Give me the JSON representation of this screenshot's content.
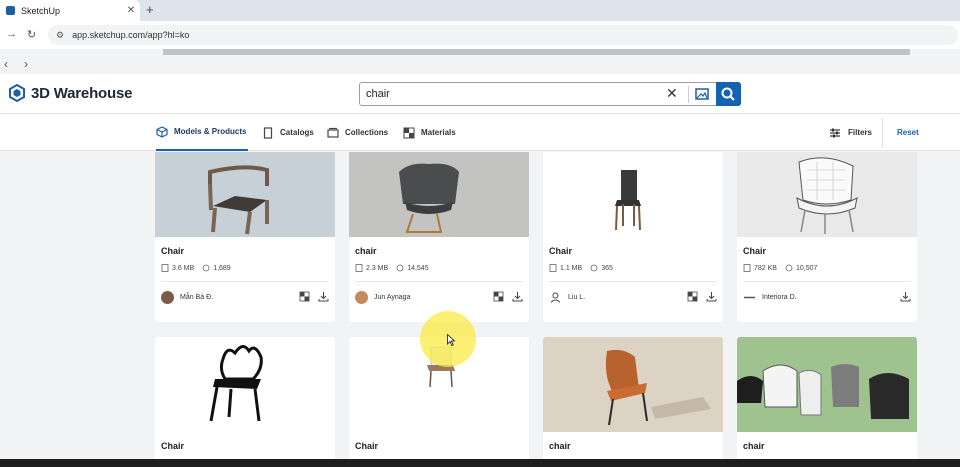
{
  "browser": {
    "tab_title": "SketchUp",
    "tab_close": "✕",
    "new_tab": "+",
    "url": "app.sketchup.com/app?hl=ko"
  },
  "app": {
    "brand": "3D Warehouse"
  },
  "search": {
    "query": "chair",
    "clear": "✕"
  },
  "categories": [
    {
      "label": "Models & Products",
      "active": true
    },
    {
      "label": "Catalogs",
      "active": false
    },
    {
      "label": "Collections",
      "active": false
    },
    {
      "label": "Materials",
      "active": false
    }
  ],
  "toolbar": {
    "filters": "Filters",
    "reset": "Reset"
  },
  "results": [
    {
      "name": "Chair",
      "size": "3.6 MB",
      "count": "1,689",
      "author": "Mẫn Bá Đ."
    },
    {
      "name": "chair",
      "size": "2.3 MB",
      "count": "14,545",
      "author": "Jun Aynaga"
    },
    {
      "name": "Chair",
      "size": "1.1 MB",
      "count": "365",
      "author": "Liu L."
    },
    {
      "name": "Chair",
      "size": "782 KB",
      "count": "10,507",
      "author": "Interiora D."
    },
    {
      "name": "Chair"
    },
    {
      "name": "Chair"
    },
    {
      "name": "chair"
    },
    {
      "name": "chair"
    }
  ],
  "colors": {
    "accent": "#1563b0",
    "highlight": "#faeb46"
  }
}
